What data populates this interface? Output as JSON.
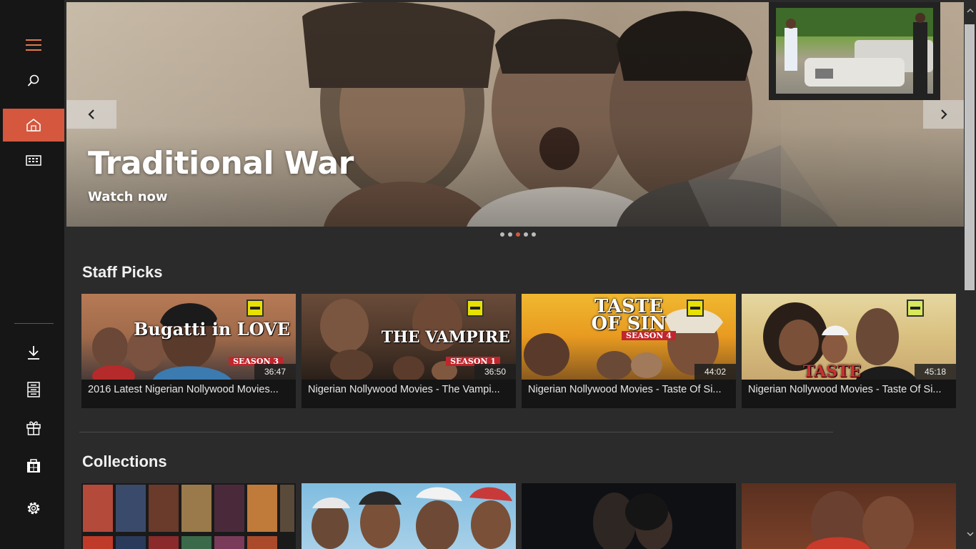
{
  "sidebar": {
    "items": [
      {
        "icon": "hamburger-menu-icon",
        "active": false
      },
      {
        "icon": "search-icon",
        "active": false
      },
      {
        "icon": "home-icon",
        "active": true
      },
      {
        "icon": "tv-guide-icon",
        "active": false
      },
      {
        "icon": "download-icon",
        "active": false
      },
      {
        "icon": "list-icon",
        "active": false
      },
      {
        "icon": "gift-icon",
        "active": false
      },
      {
        "icon": "store-icon",
        "active": false
      },
      {
        "icon": "settings-gear-icon",
        "active": false
      }
    ],
    "accent_color": "#d4573e",
    "menu_icon_color": "#e07a4a"
  },
  "hero": {
    "title": "Traditional War",
    "subtitle": "Watch now",
    "dots_total": 5,
    "dots_active_index": 2
  },
  "sections": {
    "staff_picks": {
      "title": "Staff Picks",
      "cards": [
        {
          "title": "2016 Latest Nigerian Nollywood Movies...",
          "duration": "36:47",
          "thumb_text": "Bugatti in LOVE",
          "thumb_sub": "SEASON 3"
        },
        {
          "title": "Nigerian Nollywood Movies - The Vampi...",
          "duration": "36:50",
          "thumb_text": "THE VAMPIRE",
          "thumb_sub": "SEASON 1"
        },
        {
          "title": "Nigerian Nollywood Movies - Taste Of Si...",
          "duration": "44:02",
          "thumb_text": "TASTE OF SIN",
          "thumb_sub": "SEASON 4"
        },
        {
          "title": "Nigerian Nollywood Movies - Taste Of Si...",
          "duration": "45:18",
          "thumb_text": "TASTE",
          "thumb_sub": ""
        }
      ]
    },
    "collections": {
      "title": "Collections"
    }
  }
}
